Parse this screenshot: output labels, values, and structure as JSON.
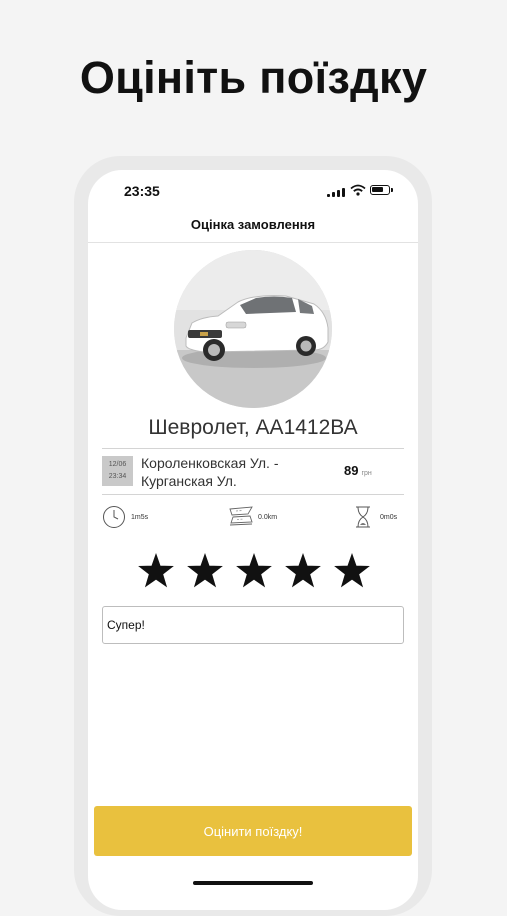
{
  "headline": "Оцініть поїздку",
  "status_bar": {
    "time": "23:35"
  },
  "nav": {
    "title": "Оцінка замовлення"
  },
  "vehicle": {
    "title": "Шевролет, АА1412ВА"
  },
  "trip": {
    "date": "12/06",
    "time": "23:34",
    "route_line1": "Короленковская Ул. -",
    "route_line2": "Курганская Ул.",
    "price": "89",
    "currency": "грн"
  },
  "stats": {
    "duration": "1m5s",
    "distance": "0.0km",
    "waiting": "0m0s"
  },
  "rating": {
    "value": 5,
    "max": 5
  },
  "comment": {
    "value": "Супер!"
  },
  "submit_label": "Оцінити поїздку!",
  "colors": {
    "accent": "#e9c13e",
    "background": "#f4f4f4"
  },
  "icons": [
    "signal-icon",
    "wifi-icon",
    "battery-icon",
    "calendar-icon",
    "clock-icon",
    "road-icon",
    "hourglass-icon",
    "star-icon"
  ]
}
